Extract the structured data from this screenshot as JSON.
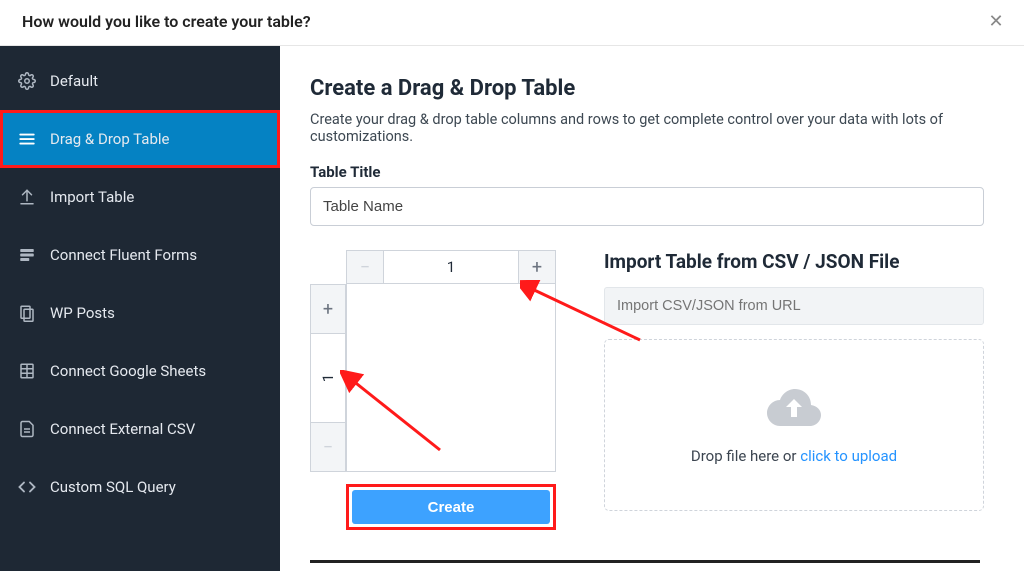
{
  "modal_title": "How would you like to create your table?",
  "sidebar": {
    "items": [
      {
        "label": "Default",
        "icon": "gear"
      },
      {
        "label": "Drag & Drop Table",
        "icon": "menu"
      },
      {
        "label": "Import Table",
        "icon": "upload"
      },
      {
        "label": "Connect Fluent Forms",
        "icon": "form"
      },
      {
        "label": "WP Posts",
        "icon": "posts"
      },
      {
        "label": "Connect Google Sheets",
        "icon": "sheets"
      },
      {
        "label": "Connect External CSV",
        "icon": "doc"
      },
      {
        "label": "Custom SQL Query",
        "icon": "code"
      }
    ],
    "active_index": 1
  },
  "page": {
    "heading": "Create a Drag & Drop Table",
    "description": "Create your drag & drop table columns and rows to get complete control over your data with lots of customizations.",
    "title_label": "Table Title",
    "title_value": "Table Name",
    "columns_value": "1",
    "rows_value": "1",
    "create_button": "Create"
  },
  "import": {
    "heading": "Import Table from CSV / JSON File",
    "url_placeholder": "Import CSV/JSON from URL",
    "drop_text": "Drop file here or ",
    "drop_link": "click to upload"
  }
}
